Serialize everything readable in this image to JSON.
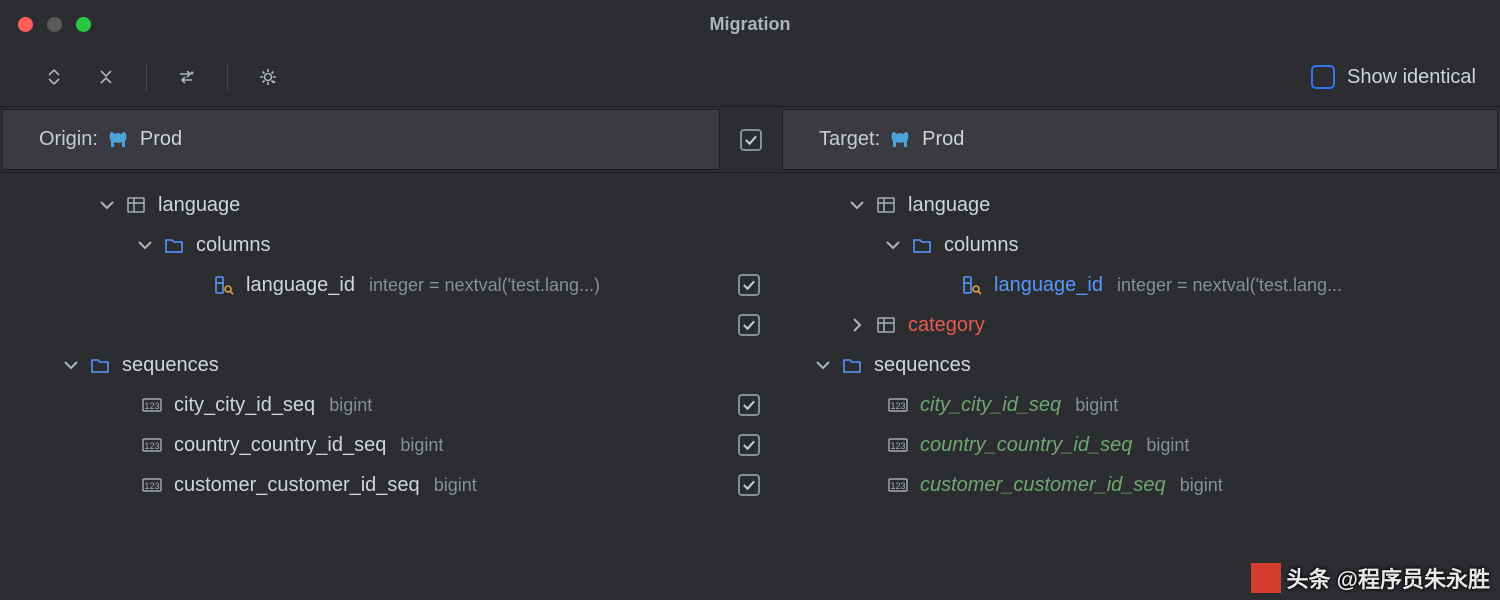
{
  "window": {
    "title": "Migration"
  },
  "toolbar": {
    "show_identical_label": "Show identical"
  },
  "panes": {
    "origin": {
      "label": "Origin:",
      "db": "Prod"
    },
    "target": {
      "label": "Target:",
      "db": "Prod"
    }
  },
  "tree": {
    "language_table": "language",
    "columns_folder": "columns",
    "language_id": "language_id",
    "language_id_detail": "integer = nextval('test.lang...)",
    "language_id_detail_r": "integer = nextval('test.lang...",
    "category_table": "category",
    "sequences_folder": "sequences",
    "seq1": "city_city_id_seq",
    "seq2": "country_country_id_seq",
    "seq3": "customer_customer_id_seq",
    "bigint": "bigint"
  },
  "watermark": {
    "text": "@程序员朱永胜",
    "prefix": "头条"
  }
}
